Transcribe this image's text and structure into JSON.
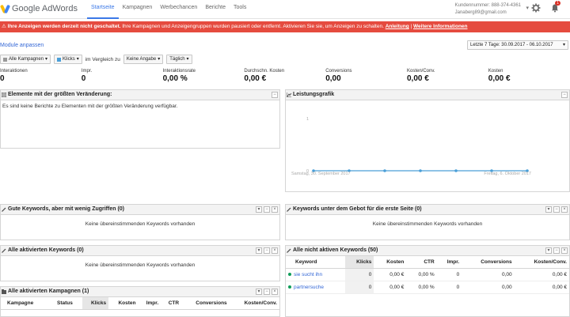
{
  "app": {
    "logo_text": "Google AdWords"
  },
  "nav": [
    "Startseite",
    "Kampagnen",
    "Werbechancen",
    "Berichte",
    "Tools"
  ],
  "account": {
    "line1": "Kundennummer: 888-374-4361",
    "line2": "Janaberg89@gmail.com",
    "notifications": "1"
  },
  "alert": {
    "bold": "Ihre Anzeigen werden derzeit nicht geschaltet.",
    "text": "Ihre Kampagnen und Anzeigengruppen wurden pausiert oder entfernt. Aktivieren Sie sie, um Anzeigen zu schalten.",
    "link1": "Anleitung",
    "sep": "|",
    "link2": "Weitere Informationen"
  },
  "modules_link": "Module anpassen",
  "date_range": "Letzte 7 Tage: 30.09.2017 - 06.10.2017",
  "controls": {
    "campaigns": "Alle Kampagnen",
    "metric": "Klicks",
    "compare_label": "im Vergleich zu",
    "compare": "Keine Angabe",
    "period": "Täglich"
  },
  "stats": [
    {
      "label": "Interaktionen",
      "value": "0"
    },
    {
      "label": "Impr.",
      "value": "0"
    },
    {
      "label": "Interaktionsrate",
      "value": "0,00 %"
    },
    {
      "label": "Durchschn. Kosten",
      "value": "0,00 €"
    },
    {
      "label": "Conversions",
      "value": "0,00"
    },
    {
      "label": "Kosten/Conv.",
      "value": "0,00 €"
    },
    {
      "label": "Kosten",
      "value": "0,00 €"
    }
  ],
  "panels": {
    "changes": {
      "title": "Elemente mit der größten Veränderung:",
      "body": "Es sind keine Berichte zu Elementen mit der größten Veränderung verfügbar."
    },
    "performance": {
      "title": "Leistungsgrafik"
    },
    "good_keywords": {
      "title": "Gute Keywords, aber mit wenig Zugriffen (0)",
      "body": "Keine übereinstimmenden Keywords vorhanden"
    },
    "below_bid": {
      "title": "Keywords unter dem Gebot für die erste Seite (0)",
      "body": "Keine übereinstimmenden Keywords vorhanden"
    },
    "active_keywords": {
      "title": "Alle aktivierten Keywords (0)",
      "body": "Keine übereinstimmenden Keywords vorhanden"
    },
    "inactive_keywords": {
      "title": "Alle nicht aktiven Keywords (50)"
    },
    "active_campaigns": {
      "title": "Alle aktivierten Kampagnen (1)"
    }
  },
  "inactive_table": {
    "columns": [
      "Keyword",
      "Klicks",
      "Kosten",
      "CTR",
      "Impr.",
      "Conversions",
      "Kosten/Conv."
    ],
    "rows": [
      [
        "sie sucht ihn",
        "0",
        "0,00 €",
        "0,00 %",
        "0",
        "0,00",
        "0,00 €"
      ],
      [
        "partnersuche",
        "0",
        "0,00 €",
        "0,00 %",
        "0",
        "0,00",
        "0,00 €"
      ]
    ]
  },
  "campaigns_table": {
    "columns": [
      "Kampagne",
      "Status",
      "Klicks",
      "Kosten",
      "Impr.",
      "CTR",
      "Conversions",
      "Kosten/Conv."
    ]
  },
  "chart_data": {
    "type": "line",
    "x": [
      "Samstag, 30. September 2017",
      "",
      "",
      "",
      "",
      "",
      "Freitag, 6. Oktober 2017"
    ],
    "series": [
      {
        "values": [
          0,
          0,
          0,
          0,
          0,
          0,
          0
        ]
      }
    ],
    "y_ticks": [
      "0",
      "1"
    ],
    "ylim": [
      0,
      1
    ],
    "x_tick_start": "Samstag, 30. September 2017",
    "x_tick_end": "Freitag, 6. Oktober 2017",
    "line_color": "#4a9fd8",
    "grid": false
  }
}
